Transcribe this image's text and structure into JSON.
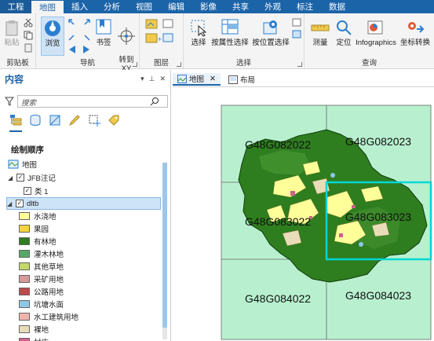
{
  "tabs": [
    "工程",
    "地图",
    "插入",
    "分析",
    "视图",
    "编辑",
    "影像",
    "共享",
    "外观",
    "标注",
    "数据"
  ],
  "ribbon": {
    "clipboard": {
      "label": "剪贴板",
      "paste": "粘贴"
    },
    "navigate": {
      "label": "导航",
      "explore": "浏览",
      "bookmarks": "书签",
      "goto_xy": "转到\nXY"
    },
    "layer": {
      "label": "图层"
    },
    "selection": {
      "label": "选择",
      "select": "选择",
      "select_by_attr": "按属性选择",
      "select_by_loc": "按位置选择"
    },
    "inquiry": {
      "label": "查询",
      "measure": "测量",
      "locate": "定位",
      "infographics": "Infographics",
      "coord_conv": "坐标转换"
    }
  },
  "contents": {
    "title": "内容",
    "search_placeholder": "搜索",
    "drawing_order": "绘制顺序",
    "map_name": "地图",
    "layers": [
      {
        "name": "JFB注记",
        "sub": "类 1"
      },
      {
        "name": "dltb"
      }
    ],
    "legend": [
      {
        "label": "水浇地",
        "color": "#ffff99"
      },
      {
        "label": "果园",
        "color": "#f5d33b"
      },
      {
        "label": "有林地",
        "color": "#2e7d1f"
      },
      {
        "label": "灌木林地",
        "color": "#56a869"
      },
      {
        "label": "其他草地",
        "color": "#c3d86a"
      },
      {
        "label": "采矿用地",
        "color": "#d79a9a"
      },
      {
        "label": "公路用地",
        "color": "#b64c4c"
      },
      {
        "label": "坑塘水面",
        "color": "#8ec7e6"
      },
      {
        "label": "水工建筑用地",
        "color": "#f0b3ad"
      },
      {
        "label": "裸地",
        "color": "#e8dcb9"
      },
      {
        "label": "村庄",
        "color": "#d0618a"
      }
    ]
  },
  "view_tabs": {
    "map": "地图",
    "layout": "布局"
  },
  "map": {
    "sheets": [
      "G48G082022",
      "G48G082023",
      "G48G083022",
      "G48G083023",
      "G48G084022",
      "G48G084023"
    ],
    "colors": {
      "sheet_fill": "#b8f0cf",
      "forest": "#2e7d1f",
      "highlight": "#00d6d6"
    }
  }
}
